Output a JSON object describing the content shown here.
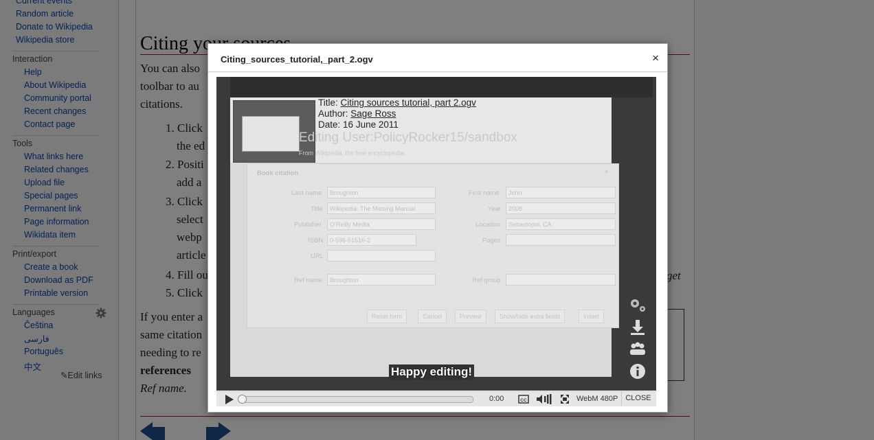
{
  "sidebar": {
    "navigation_links": [
      "Current events",
      "Random article",
      "Donate to Wikipedia",
      "Wikipedia store"
    ],
    "interaction": {
      "heading": "Interaction",
      "links": [
        "Help",
        "About Wikipedia",
        "Community portal",
        "Recent changes",
        "Contact page"
      ]
    },
    "tools": {
      "heading": "Tools",
      "links": [
        "What links here",
        "Related changes",
        "Upload file",
        "Special pages",
        "Permanent link",
        "Page information",
        "Wikidata item"
      ]
    },
    "print_export": {
      "heading": "Print/export",
      "links": [
        "Create a book",
        "Download as PDF",
        "Printable version"
      ]
    },
    "languages": {
      "heading": "Languages",
      "links": [
        "Čeština",
        "فارسی",
        "Português",
        "中文"
      ],
      "edit_links": "Edit links"
    }
  },
  "article": {
    "heading": "Citing your sources",
    "lines": [
      "You can also",
      "toolbar to au",
      "citations.",
      "1. Click",
      "the ed",
      "2. Positi",
      "add a",
      "3. Click",
      "select",
      "webp",
      "article",
      "4. Fill ou",
      "5. Click",
      "If you enter a",
      "same citation",
      "needing to re",
      "references",
      "Ref name."
    ],
    "right_fragment": "get"
  },
  "dialog": {
    "title": "Citing_sources_tutorial,_part_2.ogv",
    "close_glyph": "×",
    "video": {
      "meta_title_label": "Title:",
      "meta_title_value": "Citing sources tutorial, part 2.ogv",
      "meta_author_label": "Author:",
      "meta_author_value": "Sage Ross",
      "meta_date_label": "Date:",
      "meta_date_value": "16 June 2011",
      "subtitle": "Happy editing!",
      "background_page_title": "Editing User:PolicyRocker15/sandbox",
      "background_page_sub": "From Wikipedia, the free encyclopedia",
      "form": {
        "title": "Book citation",
        "fields": [
          {
            "label": "Last name",
            "value": "Broughton"
          },
          {
            "label": "First name",
            "value": "John"
          },
          {
            "label": "Title",
            "value": "Wikipedia: The Missing Manual"
          },
          {
            "label": "Year",
            "value": "2008"
          },
          {
            "label": "Publisher",
            "value": "O'Reilly Media"
          },
          {
            "label": "Location",
            "value": "Sebastopol, CA"
          },
          {
            "label": "ISBN",
            "value": "0-596-51516-2"
          },
          {
            "label": "Pages",
            "value": ""
          },
          {
            "label": "URL",
            "value": ""
          },
          {
            "label": "Ref name",
            "value": "Broughton"
          },
          {
            "label": "Ref group",
            "value": ""
          }
        ],
        "buttons": [
          "Reset form",
          "Cancel",
          "Preview",
          "Show/hide extra fields",
          "Insert"
        ]
      },
      "side_icons": [
        "settings-gears-icon",
        "download-icon",
        "share-people-icon",
        "info-icon"
      ]
    },
    "controls": {
      "time": "0:00",
      "progress": 0,
      "quality": "WebM 480P",
      "close_label": "CLOSE"
    }
  },
  "colors": {
    "link": "#0645ad",
    "overlay": "rgba(0,0,0,0.5)",
    "heading_rule": "#b0141c"
  }
}
